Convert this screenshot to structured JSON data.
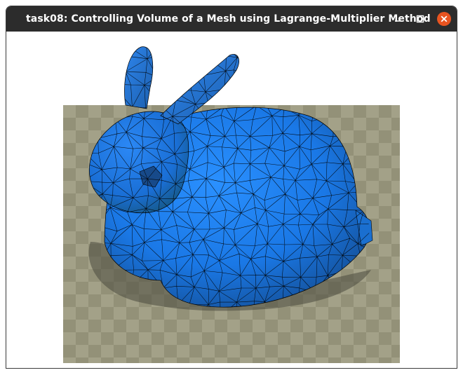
{
  "window": {
    "title": "task08: Controlling Volume of a Mesh using Lagrange-Multiplier Method",
    "controls": {
      "minimize_icon": "minimize-icon",
      "maximize_icon": "maximize-icon",
      "close_icon": "close-icon",
      "close_color": "#e95420"
    }
  },
  "scene": {
    "background": "#ffffff",
    "floor_colors": [
      "#a3a188",
      "#939178"
    ],
    "mesh_color": "#1e7df0",
    "edge_color": "#000000"
  }
}
